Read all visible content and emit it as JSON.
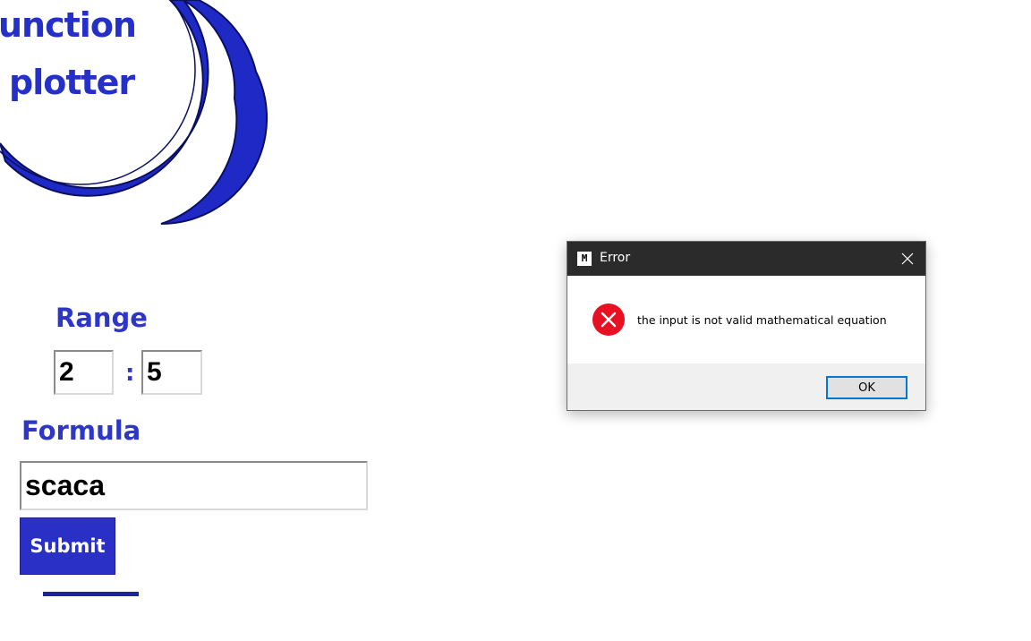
{
  "logo": {
    "line1": "unction",
    "line2": "plotter",
    "color": "#2530c8"
  },
  "form": {
    "range_label": "Range",
    "range_min": "2",
    "range_separator": ":",
    "range_max": "5",
    "formula_label": "Formula",
    "formula_value": "scaca",
    "submit_label": "Submit"
  },
  "dialog": {
    "title": "Error",
    "app_icon": "app-icon",
    "message": "the input is not valid mathematical equation",
    "ok_label": "OK",
    "icon": "error-circle-icon",
    "error_color": "#e81123",
    "accent_color": "#0078d7"
  }
}
